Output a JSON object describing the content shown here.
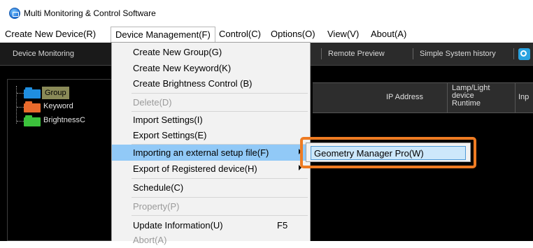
{
  "window": {
    "title": "Multi Monitoring & Control Software"
  },
  "menubar": [
    {
      "label": "Create New Device(R)"
    },
    {
      "label": "Device Management(F)"
    },
    {
      "label": "Control(C)"
    },
    {
      "label": "Options(O)"
    },
    {
      "label": "View(V)"
    },
    {
      "label": "About(A)"
    }
  ],
  "tabs": [
    {
      "label": "Device Monitoring"
    },
    {
      "label": "Remote Preview"
    },
    {
      "label": "Simple System history"
    }
  ],
  "tree": [
    {
      "label": "Group",
      "color": "#1f8ee0"
    },
    {
      "label": "Keyword",
      "color": "#e86a2c"
    },
    {
      "label": "BrightnessC",
      "color": "#3cc23c"
    }
  ],
  "grid": {
    "columns": [
      "IP Address",
      "Lamp/Light device Runtime",
      "Inp"
    ]
  },
  "menu": {
    "items": [
      {
        "label": "Create New Group(G)"
      },
      {
        "label": "Create New Keyword(K)"
      },
      {
        "label": "Create Brightness Control (B)"
      },
      {
        "label": "Delete(D)",
        "disabled": true
      },
      {
        "label": "Import Settings(I)"
      },
      {
        "label": "Export Settings(E)"
      },
      {
        "label": "Importing an external setup file(F)",
        "submenu": true,
        "highlighted": true
      },
      {
        "label": "Export of Registered device(H)",
        "submenu": true
      },
      {
        "label": "Schedule(C)"
      },
      {
        "label": "Property(P)",
        "disabled": true
      },
      {
        "label": "Update Information(U)",
        "shortcut": "F5"
      },
      {
        "label": "Abort(A)",
        "disabled": true
      }
    ]
  },
  "submenu": {
    "items": [
      {
        "label": "Geometry Manager Pro(W)"
      }
    ]
  },
  "colors": {
    "callout": "#ee7b22",
    "highlight": "#91c9f7",
    "tree_selected": "#8a8a58"
  }
}
